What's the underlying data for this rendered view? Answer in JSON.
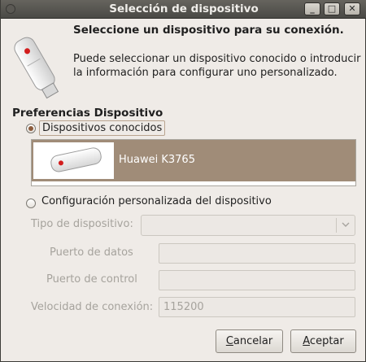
{
  "window": {
    "title": "Selección de dispositivo",
    "controls": {
      "minimize": "_",
      "maximize": "□",
      "close": "✕"
    }
  },
  "header": {
    "heading": "Seleccione un dispositivo para su conexión.",
    "description": "Puede seleccionar un dispositivo conocido o introducir la información para configurar uno personalizado."
  },
  "preferences": {
    "section_title": "Preferencias Dispositivo",
    "known_option_label": "Dispositivos conocidos",
    "known_selected": true,
    "devices": [
      {
        "name": "Huawei K3765",
        "icon": "usb-modem-icon",
        "selected": true
      }
    ],
    "custom_option_label": "Configuración personalizada del dispositivo",
    "custom_selected": false
  },
  "custom": {
    "device_type_label": "Tipo de dispositivo:",
    "device_type_value": "",
    "data_port_label": "Puerto de datos",
    "data_port_value": "",
    "control_port_label": "Puerto de control",
    "control_port_value": "",
    "speed_label": "Velocidad de conexión:",
    "speed_value": "115200",
    "enabled": false
  },
  "buttons": {
    "cancel_label": "Cancelar",
    "cancel_mnemonic": "C",
    "accept_label": "Aceptar",
    "accept_mnemonic": "A"
  },
  "colors": {
    "selection": "#a08c78",
    "radio_dot": "#8c5b3c",
    "titlebar": "#4a4945",
    "background": "#efebe7"
  }
}
